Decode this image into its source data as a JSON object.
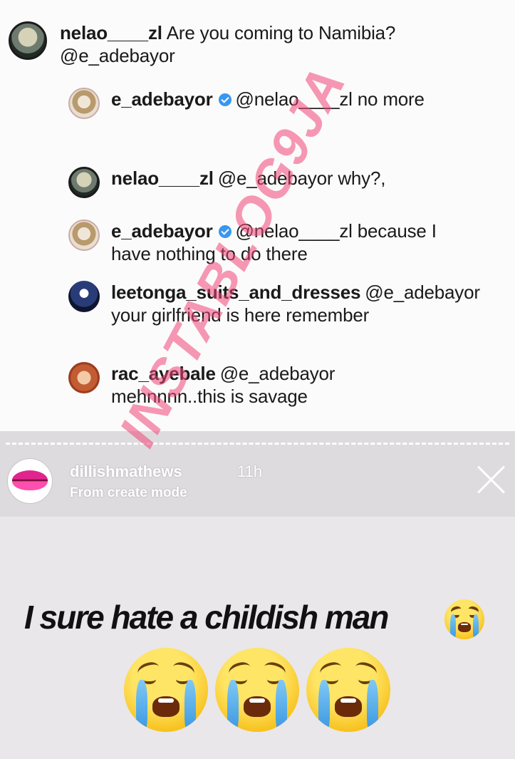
{
  "comments": [
    {
      "user": "nelao____zl",
      "text": "Are you coming to Namibia? @e_adebayor",
      "verified": false
    },
    {
      "user": "e_adebayor",
      "text": "@nelao____zl no more",
      "verified": true
    },
    {
      "user": "nelao____zl",
      "text": "@e_adebayor  why?,",
      "verified": false
    },
    {
      "user": "e_adebayor",
      "text": "@nelao____zl because I have nothing to do there",
      "verified": true
    },
    {
      "user": "leetonga_suits_and_dresses",
      "text": "@e_adebayor your girlfriend is here remember",
      "verified": false
    },
    {
      "user": "rac_ayebale",
      "text": "@e_adebayor mehnnnn..this is savage",
      "verified": false
    }
  ],
  "story": {
    "user": "dillishmathews",
    "time": "11h",
    "mode": "From create mode",
    "caption": "I sure hate a childish man"
  },
  "watermark": "INSTABLOG9JA",
  "colors": {
    "verified": "#3897f0",
    "story_bg": "#e9e7ea",
    "watermark": "#f04678"
  },
  "icons": [
    "verified-badge-icon",
    "close-icon",
    "crying-face-emoji"
  ]
}
